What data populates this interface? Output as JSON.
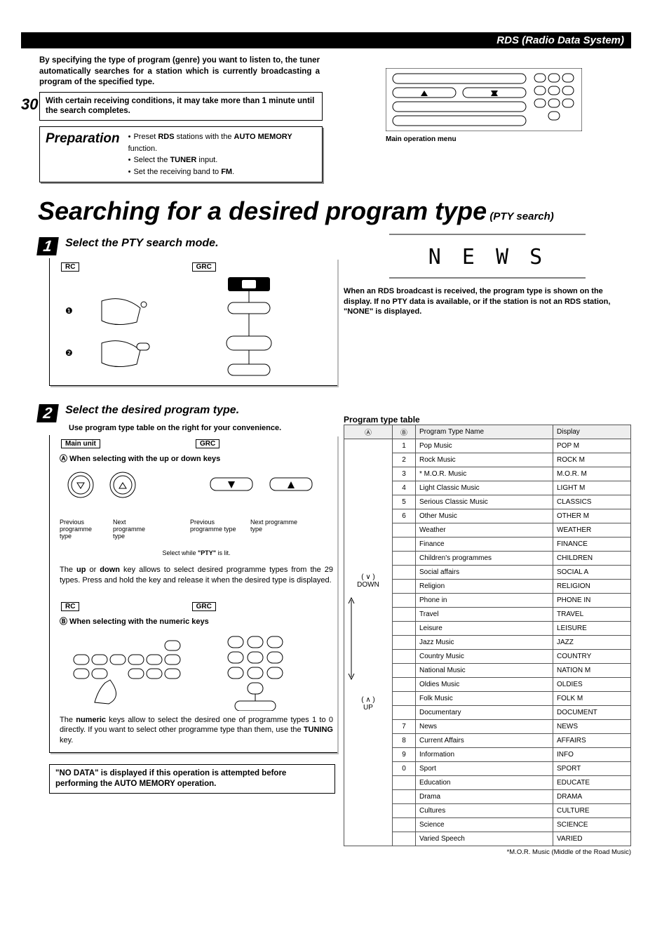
{
  "header": {
    "section": "RDS (Radio Data System)",
    "pageNum": "30"
  },
  "intro": "By specifying the type of program (genre) you want to listen to, the tuner automatically searches for a station which is currently broadcasting a program of the specified type.",
  "noteBox": "With certain receiving conditions, it may take more than 1 minute until the search completes.",
  "preparation": {
    "label": "Preparation",
    "items": {
      "a_pre": "Preset ",
      "a_b1": "RDS",
      "a_mid": " stations with the ",
      "a_b2": "AUTO MEMORY",
      "a_post": " function.",
      "b_pre": "Select the ",
      "b_b": "TUNER",
      "b_post": " input.",
      "c_pre": "Set the receiving band to ",
      "c_b": "FM",
      "c_post": "."
    }
  },
  "mainTitle": {
    "big": "Searching for a desired program type",
    "sub": " (PTY search)"
  },
  "menu": {
    "caption": "Main operation menu"
  },
  "step1": {
    "num": "1",
    "title": "Select the PTY search mode.",
    "rc": "RC",
    "grc": "GRC"
  },
  "lcd": {
    "text": "N E W S"
  },
  "rightNote": "When an RDS broadcast is received, the program type is shown on the display.  If no PTY data is available, or if the station is not an RDS station, \"NONE\" is displayed.",
  "step2": {
    "num": "2",
    "title": "Select the desired program type.",
    "sub": "Use program type table on the right for your convenience.",
    "mainUnit": "Main unit",
    "grc": "GRC",
    "aLine": " When selecting with the up or down keys",
    "aSym": "Ⓐ",
    "labels": {
      "prevType": "Previous programme type",
      "nextType": "Next programme type"
    },
    "selectWhile_pre": "Select while ",
    "selectWhile_b": "\"PTY\"",
    "selectWhile_post": " is lit.",
    "upDownText_pre": "The ",
    "upDownText_b1": "up",
    "upDownText_mid1": " or ",
    "upDownText_b2": "down",
    "upDownText_post": " key allows to select desired programme types from the 29 types. Press and hold the key and release it when the desired type is displayed.",
    "rc": "RC",
    "grc2": "GRC",
    "bSym": "Ⓑ",
    "bLine": " When selecting with the numeric keys",
    "numericText_pre": "The ",
    "numericText_b": "numeric",
    "numericText_mid": " keys allow to select the desired one of programme types 1 to 0 directly. If you want to select other programme type than them, use the ",
    "numericText_b2": "TUNING",
    "numericText_post": " key."
  },
  "noDataNote": "\"NO DATA\" is displayed if this operation is attempted before performing the AUTO MEMORY operation.",
  "programTable": {
    "heading": "Program type table",
    "headers": {
      "a": "Ⓐ",
      "b": "Ⓑ",
      "name": "Program Type Name",
      "disp": "Display"
    },
    "groupA": {
      "down": "( ∨ )\nDOWN",
      "arrow": "↕",
      "up": "( ∧ )\nUP"
    },
    "rows": [
      {
        "b": "1",
        "name": "Pop Music",
        "disp": "POP M"
      },
      {
        "b": "2",
        "name": "Rock Music",
        "disp": "ROCK M"
      },
      {
        "b": "3",
        "name": "* M.O.R. Music",
        "disp": "M.O.R. M"
      },
      {
        "b": "4",
        "name": "Light Classic Music",
        "disp": "LIGHT M"
      },
      {
        "b": "5",
        "name": "Serious Classic Music",
        "disp": "CLASSICS"
      },
      {
        "b": "6",
        "name": "Other Music",
        "disp": "OTHER M"
      },
      {
        "b": "",
        "name": "Weather",
        "disp": "WEATHER"
      },
      {
        "b": "",
        "name": "Finance",
        "disp": "FINANCE"
      },
      {
        "b": "",
        "name": "Children's programmes",
        "disp": "CHILDREN"
      },
      {
        "b": "",
        "name": "Social affairs",
        "disp": "SOCIAL A"
      },
      {
        "b": "",
        "name": "Religion",
        "disp": "RELIGION"
      },
      {
        "b": "",
        "name": "Phone in",
        "disp": "PHONE IN"
      },
      {
        "b": "",
        "name": "Travel",
        "disp": "TRAVEL"
      },
      {
        "b": "",
        "name": "Leisure",
        "disp": "LEISURE"
      },
      {
        "b": "",
        "name": "Jazz Music",
        "disp": "JAZZ"
      },
      {
        "b": "",
        "name": "Country Music",
        "disp": "COUNTRY"
      },
      {
        "b": "",
        "name": "National Music",
        "disp": "NATION M"
      },
      {
        "b": "",
        "name": "Oldies Music",
        "disp": "OLDIES"
      },
      {
        "b": "",
        "name": "Folk Music",
        "disp": "FOLK M"
      },
      {
        "b": "",
        "name": "Documentary",
        "disp": "DOCUMENT"
      },
      {
        "b": "7",
        "name": "News",
        "disp": "NEWS"
      },
      {
        "b": "8",
        "name": "Current Affairs",
        "disp": "AFFAIRS"
      },
      {
        "b": "9",
        "name": "Information",
        "disp": "INFO"
      },
      {
        "b": "0",
        "name": "Sport",
        "disp": "SPORT"
      },
      {
        "b": "",
        "name": "Education",
        "disp": "EDUCATE"
      },
      {
        "b": "",
        "name": "Drama",
        "disp": "DRAMA"
      },
      {
        "b": "",
        "name": "Cultures",
        "disp": "CULTURE"
      },
      {
        "b": "",
        "name": "Science",
        "disp": "SCIENCE"
      },
      {
        "b": "",
        "name": "Varied Speech",
        "disp": "VARIED"
      }
    ],
    "footnote": "*M.O.R. Music (Middle of the Road Music)"
  }
}
